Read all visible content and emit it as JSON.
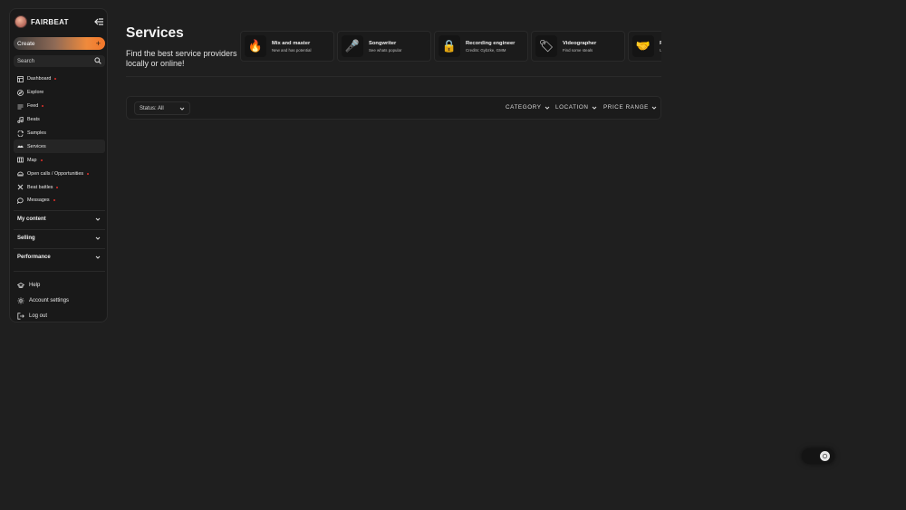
{
  "brand": {
    "name": "FAIRBEAT"
  },
  "sidebar": {
    "create_label": "Create",
    "search_placeholder": "Search",
    "items": [
      {
        "label": "Dashboard",
        "icon": "dashboard-icon",
        "dot": true
      },
      {
        "label": "Explore",
        "icon": "compass-icon",
        "dot": false
      },
      {
        "label": "Feed",
        "icon": "feed-icon",
        "dot": true
      },
      {
        "label": "Beats",
        "icon": "music-note-icon",
        "dot": false
      },
      {
        "label": "Samples",
        "icon": "samples-icon",
        "dot": false
      },
      {
        "label": "Services",
        "icon": "services-icon",
        "dot": false,
        "active": true
      },
      {
        "label": "Map",
        "icon": "map-icon",
        "dot": true
      },
      {
        "label": "Open calls / Opportunities",
        "icon": "opportunities-icon",
        "dot": true
      },
      {
        "label": "Beat battles",
        "icon": "battle-icon",
        "dot": true
      },
      {
        "label": "Messages",
        "icon": "message-icon",
        "dot": true
      }
    ],
    "sections": [
      {
        "label": "My content"
      },
      {
        "label": "Selling"
      },
      {
        "label": "Performance"
      }
    ],
    "footer": [
      {
        "label": "Help",
        "icon": "help-icon"
      },
      {
        "label": "Account settings",
        "icon": "settings-icon"
      },
      {
        "label": "Log out",
        "icon": "logout-icon"
      }
    ]
  },
  "main": {
    "title": "Services",
    "subtitle": "Find the best service providers locally or online!",
    "categories": [
      {
        "title": "Mix and master",
        "subtitle": "New and has potential",
        "icon": "fire-emoji",
        "glyph": "🔥"
      },
      {
        "title": "Songwriter",
        "subtitle": "See whats popular",
        "icon": "microphone-emoji",
        "glyph": "🎤"
      },
      {
        "title": "Recording engineer",
        "subtitle": "Credits: Gybzke, GMM",
        "icon": "lock-emoji",
        "glyph": "🔒"
      },
      {
        "title": "Videographer",
        "subtitle": "Find some steals",
        "icon": "tag-emoji",
        "glyph": "🏷"
      },
      {
        "title": "F",
        "subtitle": "U",
        "icon": "handshake-emoji",
        "glyph": "🤝"
      }
    ],
    "filters": {
      "status": "Status: All",
      "category": "CATEGORY",
      "location": "LOCATION",
      "price_range": "PRICE RANGE"
    }
  },
  "colors": {
    "accent": "#f2762a",
    "background": "#1f1f1f",
    "dot": "#e0302b"
  }
}
